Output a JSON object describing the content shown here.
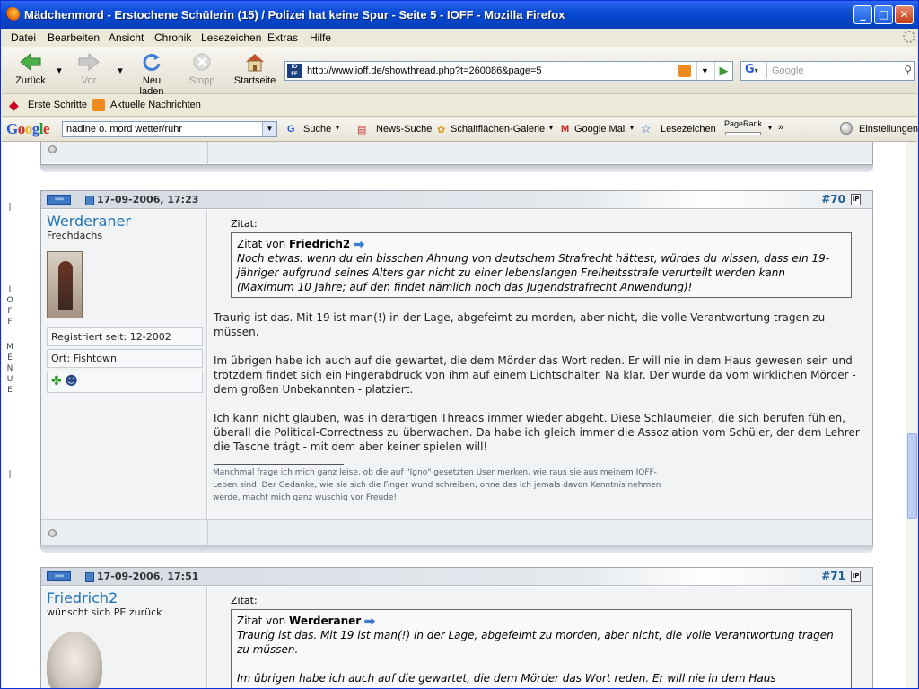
{
  "window": {
    "title": "Mädchenmord - Erstochene Schülerin (15) / Polizei hat keine Spur - Seite 5 - IOFF - Mozilla Firefox"
  },
  "menu": [
    "Datei",
    "Bearbeiten",
    "Ansicht",
    "Chronik",
    "Lesezeichen",
    "Extras",
    "Hilfe"
  ],
  "nav": {
    "back": "Zurück",
    "forward": "Vor",
    "reload": "Neu laden",
    "stop": "Stopp",
    "home": "Startseite"
  },
  "url": "http://www.ioff.de/showthread.php?t=260086&page=5",
  "search_placeholder": "Google",
  "bookmarks": [
    "Erste Schritte",
    "Aktuelle Nachrichten"
  ],
  "google_toolbar": {
    "logo": "Google",
    "query": "nadine o. mord wetter/ruhr",
    "items": [
      "Suche",
      "News-Suche",
      "Schaltflächen-Galerie",
      "Google Mail",
      "Lesezeichen",
      "PageRank",
      "Einstellungen"
    ],
    "more": "»"
  },
  "side_menu_letters": [
    "I",
    "O",
    "F",
    "F",
    "",
    "M",
    "E",
    "N",
    "U",
    "E"
  ],
  "posts": [
    {
      "date": "17-09-2006, 17:23",
      "number": "#70",
      "author": "Werderaner",
      "user_title": "Frechdachs",
      "registered": "Registriert seit: 12-2002",
      "location": "Ort: Fishtown",
      "quote_label": "Zitat:",
      "quote_from": "Zitat von",
      "quote_author": "Friedrich2",
      "quote_text": "Noch etwas: wenn du ein bisschen Ahnung von deutschem Strafrecht hättest, würdes du wissen, dass ein 19-jähriger aufgrund seines Alters gar nicht zu einer lebenslangen Freiheitsstrafe verurteilt werden kann (Maximum 10 Jahre; auf den findet nämlich noch das Jugendstrafrecht Anwendung)!",
      "paragraphs": [
        "Traurig ist das. Mit 19 ist man(!) in der Lage, abgefeimt zu morden, aber nicht, die volle Verantwortung tragen zu müssen.",
        "Im übrigen habe ich auch auf die gewartet, die dem Mörder das Wort reden. Er will nie in dem Haus gewesen sein und trotzdem findet sich ein Fingerabdruck von ihm auf einem Lichtschalter. Na klar. Der wurde da vom wirklichen Mörder - dem großen Unbekannten - platziert.",
        "Ich kann nicht glauben, was in derartigen Threads immer wieder abgeht. Diese Schlaumeier, die sich berufen fühlen, überall die Political-Correctness zu überwachen. Da habe ich gleich immer die Assoziation vom Schüler, der dem Lehrer die Tasche trägt - mit dem aber keiner spielen will!"
      ],
      "signature": "Manchmal frage ich mich ganz leise, ob die auf \"Igno\" gesetzten User merken, wie raus sie aus meinem IOFF-Leben sind. Der Gedanke, wie sie sich die Finger wund schreiben, ohne das ich jemals davon Kenntnis nehmen werde, macht mich ganz wuschig vor Freude!"
    },
    {
      "date": "17-09-2006, 17:51",
      "number": "#71",
      "author": "Friedrich2",
      "user_title": "wünscht sich PE zurück",
      "quote_label": "Zitat:",
      "quote_from": "Zitat von",
      "quote_author": "Werderaner",
      "quote_text": "Traurig ist das. Mit 19 ist man(!) in der Lage, abgefeimt zu morden, aber nicht, die volle Verantwortung tragen zu müssen.",
      "quote_text2": "Im übrigen habe ich auch auf die gewartet, die dem Mörder das Wort reden. Er will nie in dem Haus"
    }
  ]
}
